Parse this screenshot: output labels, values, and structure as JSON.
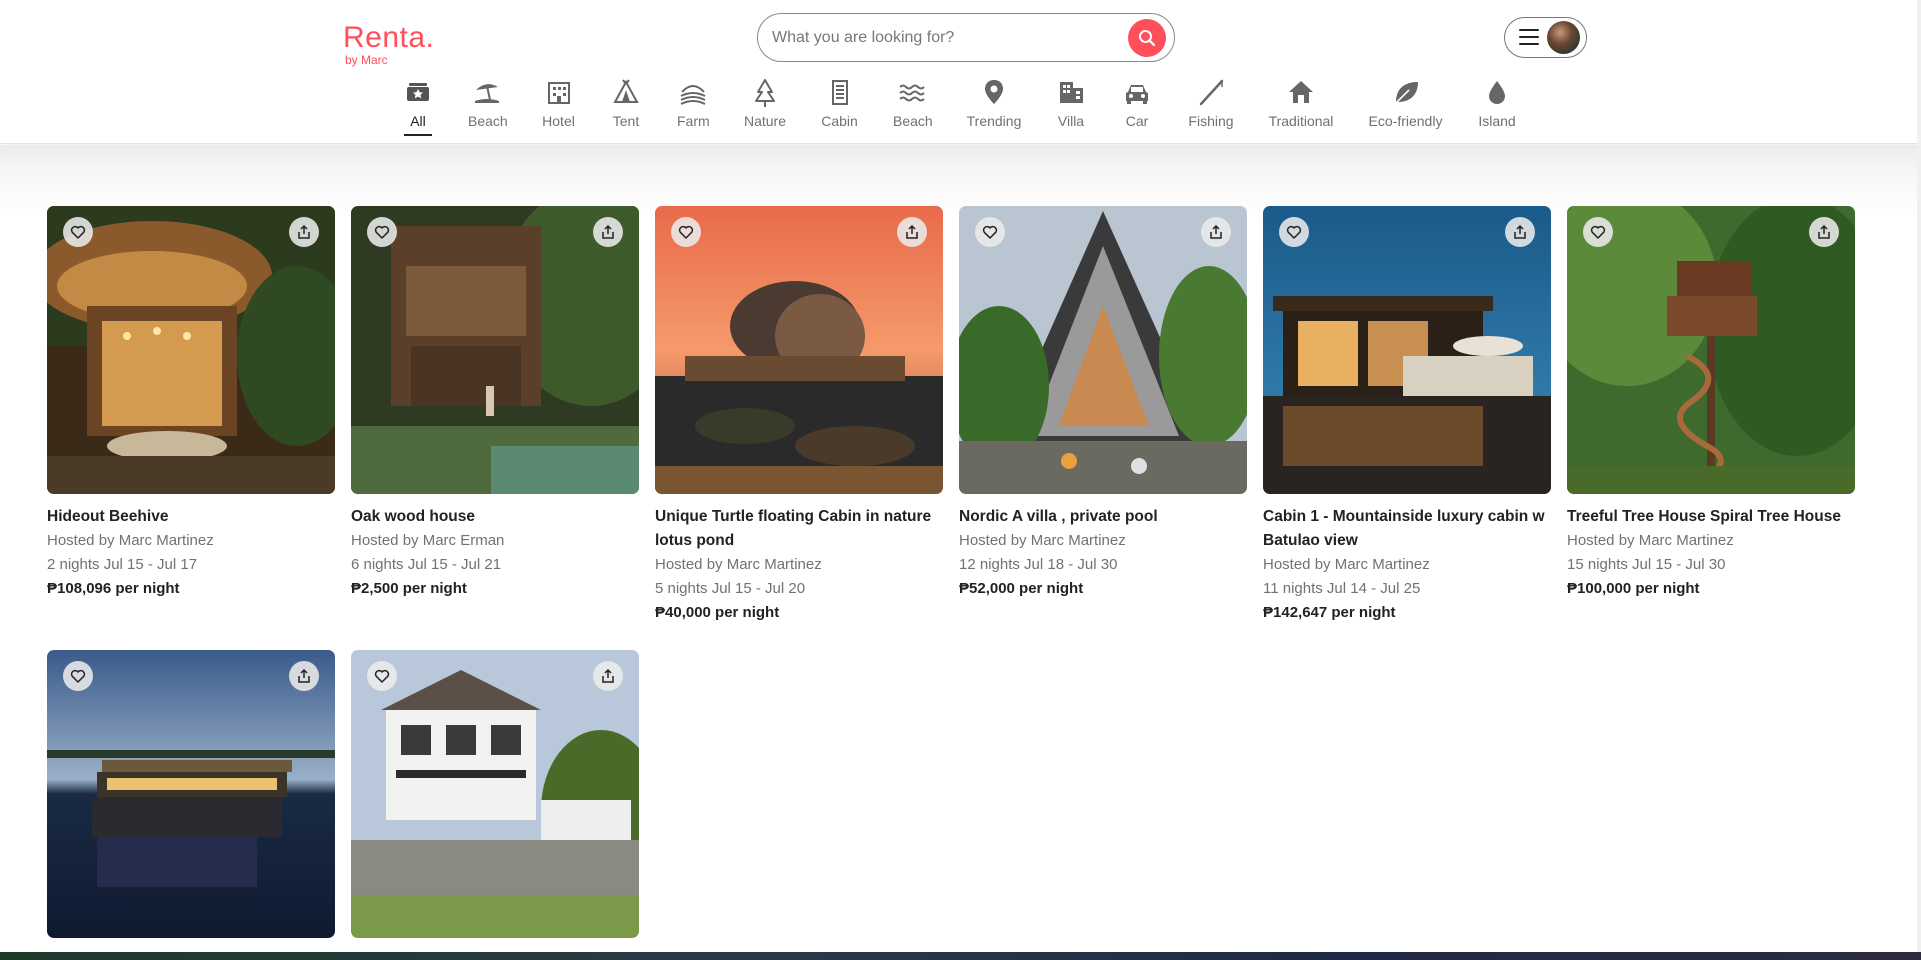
{
  "logo": {
    "title": "Renta.",
    "subtitle": "by Marc"
  },
  "search": {
    "placeholder": "What you are looking for?"
  },
  "colors": {
    "brand": "#ff4f5a"
  },
  "categories": [
    {
      "label": "All",
      "icon": "ticket-star-icon",
      "active": true
    },
    {
      "label": "Beach",
      "icon": "beach-umbrella-icon"
    },
    {
      "label": "Hotel",
      "icon": "hotel-building-icon"
    },
    {
      "label": "Tent",
      "icon": "tent-icon"
    },
    {
      "label": "Farm",
      "icon": "farm-icon"
    },
    {
      "label": "Nature",
      "icon": "tree-icon"
    },
    {
      "label": "Cabin",
      "icon": "cabin-building-icon"
    },
    {
      "label": "Beach",
      "icon": "waves-icon"
    },
    {
      "label": "Trending",
      "icon": "map-pin-icon"
    },
    {
      "label": "Villa",
      "icon": "villa-building-icon"
    },
    {
      "label": "Car",
      "icon": "car-icon"
    },
    {
      "label": "Fishing",
      "icon": "fishing-rod-icon"
    },
    {
      "label": "Traditional",
      "icon": "house-icon"
    },
    {
      "label": "Eco-friendly",
      "icon": "leaf-icon"
    },
    {
      "label": "Island",
      "icon": "water-drop-icon"
    }
  ],
  "listings": [
    {
      "title": "Hideout Beehive",
      "host": "Hosted by Marc Martinez",
      "dates": "2 nights Jul 15 - Jul 17",
      "price": "₱108,096 per night"
    },
    {
      "title": "Oak wood house",
      "host": "Hosted by Marc Erman",
      "dates": "6 nights Jul 15 - Jul 21",
      "price": "₱2,500 per night"
    },
    {
      "title": "Unique Turtle floating Cabin in nature lotus pond",
      "host": "Hosted by Marc Martinez",
      "dates": "5 nights Jul 15 - Jul 20",
      "price": "₱40,000 per night"
    },
    {
      "title": "Nordic A villa , private pool",
      "host": "Hosted by Marc Martinez",
      "dates": "12 nights Jul 18 - Jul 30",
      "price": "₱52,000 per night"
    },
    {
      "title": "Cabin 1 - Mountainside luxury cabin w Batulao view",
      "host": "Hosted by Marc Martinez",
      "dates": "11 nights Jul 14 - Jul 25",
      "price": "₱142,647 per night"
    },
    {
      "title": "Treeful Tree House Spiral Tree House",
      "host": "Hosted by Marc Martinez",
      "dates": "15 nights Jul 15 - Jul 30",
      "price": "₱100,000 per night"
    },
    {
      "title": "",
      "host": "",
      "dates": "",
      "price": ""
    },
    {
      "title": "",
      "host": "",
      "dates": "",
      "price": ""
    }
  ]
}
